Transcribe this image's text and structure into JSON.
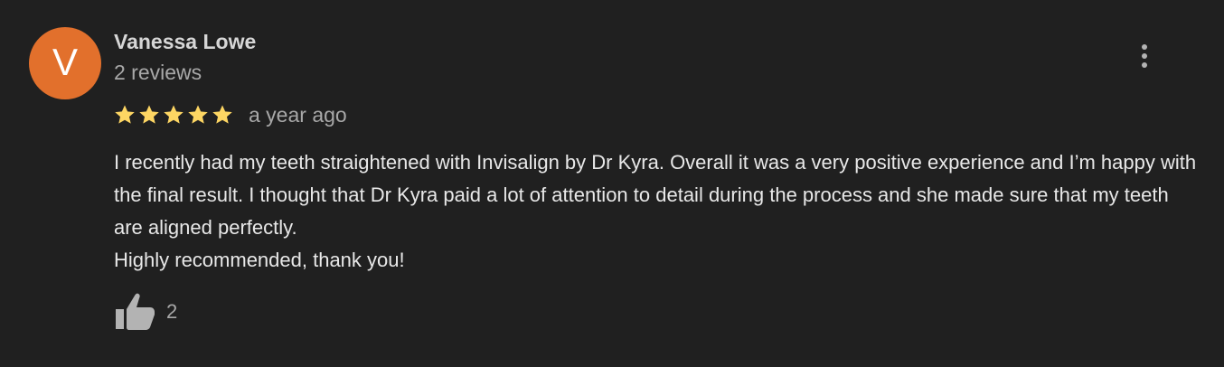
{
  "reviewer": {
    "initial": "V",
    "name": "Vanessa Lowe",
    "review_count": "2 reviews",
    "avatar_color": "#e2702c"
  },
  "review": {
    "rating": 5,
    "max_rating": 5,
    "star_color": "#fdd663",
    "date": "a year ago",
    "text_lines": [
      "I recently had my teeth straightened with Invisalign by Dr Kyra. Overall it was a very positive experience and I’m happy with the final result. I thought that Dr Kyra paid a lot of attention to detail during the process and she made sure that my teeth are aligned perfectly.",
      "Highly recommended, thank you!"
    ]
  },
  "actions": {
    "like_count": "2",
    "like_icon": "thumbs-up-icon",
    "more_icon": "more-vert-icon"
  }
}
